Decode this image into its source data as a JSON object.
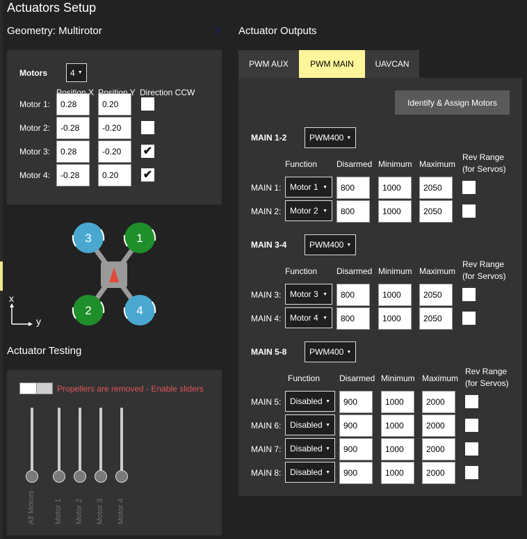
{
  "page": {
    "title": "Actuators Setup"
  },
  "geometry": {
    "heading": "Geometry: Multirotor",
    "help_icon": "?",
    "motors_label": "Motors",
    "motors_count": "4",
    "col_x": "Position X",
    "col_y": "Position Y",
    "col_dir": "Direction CCW",
    "rows": [
      {
        "label": "Motor 1:",
        "x": "0.28",
        "y": "0.20",
        "ccw": false
      },
      {
        "label": "Motor 2:",
        "x": "-0.28",
        "y": "-0.20",
        "ccw": false
      },
      {
        "label": "Motor 3:",
        "x": "0.28",
        "y": "-0.20",
        "ccw": true
      },
      {
        "label": "Motor 4:",
        "x": "-0.28",
        "y": "0.20",
        "ccw": true
      }
    ],
    "diagram": {
      "motor_labels": [
        "1",
        "2",
        "3",
        "4"
      ],
      "axis_x": "x",
      "axis_y": "y",
      "colors": {
        "cw": "#1f8f2b",
        "ccw": "#4aa8d0",
        "body": "#9a9a9a",
        "arrow": "#e24a3a"
      }
    }
  },
  "testing": {
    "heading": "Actuator Testing",
    "warning": "Propellers are removed - Enable sliders",
    "sliders": [
      {
        "label": "All Motors"
      },
      {
        "label": "Motor 1"
      },
      {
        "label": "Motor 2"
      },
      {
        "label": "Motor 3"
      },
      {
        "label": "Motor 4"
      }
    ]
  },
  "outputs": {
    "heading": "Actuator Outputs",
    "tabs": [
      {
        "label": "PWM AUX",
        "active": false
      },
      {
        "label": "PWM MAIN",
        "active": true
      },
      {
        "label": "UAVCAN",
        "active": false
      }
    ],
    "identify_button": "Identify & Assign Motors",
    "col_function": "Function",
    "col_disarmed": "Disarmed",
    "col_minimum": "Minimum",
    "col_maximum": "Maximum",
    "col_rev_1": "Rev Range",
    "col_rev_2": "(for Servos)",
    "groups": [
      {
        "label": "MAIN 1-2",
        "rate": "PWM400",
        "rows": [
          {
            "label": "MAIN 1:",
            "function": "Motor 1",
            "disarmed": "800",
            "minimum": "1000",
            "maximum": "2050",
            "rev": false
          },
          {
            "label": "MAIN 2:",
            "function": "Motor 2",
            "disarmed": "800",
            "minimum": "1000",
            "maximum": "2050",
            "rev": false
          }
        ]
      },
      {
        "label": "MAIN 3-4",
        "rate": "PWM400",
        "rows": [
          {
            "label": "MAIN 3:",
            "function": "Motor 3",
            "disarmed": "800",
            "minimum": "1000",
            "maximum": "2050",
            "rev": false
          },
          {
            "label": "MAIN 4:",
            "function": "Motor 4",
            "disarmed": "800",
            "minimum": "1000",
            "maximum": "2050",
            "rev": false
          }
        ]
      },
      {
        "label": "MAIN 5-8",
        "rate": "PWM400",
        "rows": [
          {
            "label": "MAIN 5:",
            "function": "Disabled",
            "disarmed": "900",
            "minimum": "1000",
            "maximum": "2000",
            "rev": false
          },
          {
            "label": "MAIN 6:",
            "function": "Disabled",
            "disarmed": "900",
            "minimum": "1000",
            "maximum": "2000",
            "rev": false
          },
          {
            "label": "MAIN 7:",
            "function": "Disabled",
            "disarmed": "900",
            "minimum": "1000",
            "maximum": "2000",
            "rev": false
          },
          {
            "label": "MAIN 8:",
            "function": "Disabled",
            "disarmed": "900",
            "minimum": "1000",
            "maximum": "2000",
            "rev": false
          }
        ]
      }
    ]
  }
}
